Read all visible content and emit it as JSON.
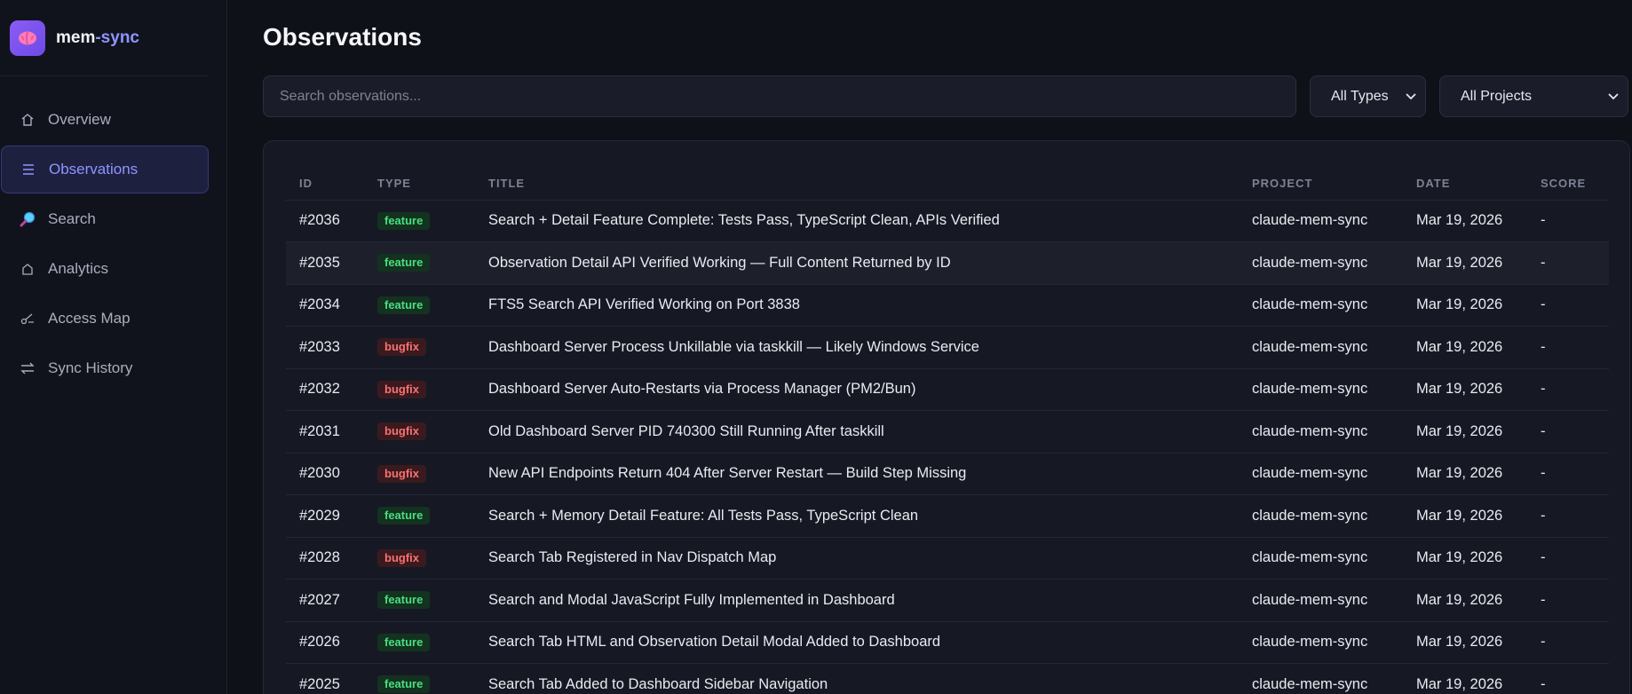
{
  "brand": {
    "name_main": "mem",
    "name_accent": "-sync"
  },
  "colors": {
    "accent": "#8f95ff",
    "feature": "#4ade80",
    "bugfix": "#f87171",
    "background": "#0f1118"
  },
  "sidebar": {
    "items": [
      {
        "label": "Overview",
        "icon": "home-icon",
        "active": false
      },
      {
        "label": "Observations",
        "icon": "list-icon",
        "active": true
      },
      {
        "label": "Search",
        "icon": "search-icon",
        "active": false
      },
      {
        "label": "Analytics",
        "icon": "analytics-icon",
        "active": false
      },
      {
        "label": "Access Map",
        "icon": "access-map-icon",
        "active": false
      },
      {
        "label": "Sync History",
        "icon": "sync-icon",
        "active": false
      }
    ]
  },
  "page": {
    "title": "Observations"
  },
  "filters": {
    "search_placeholder": "Search observations...",
    "type_selected": "All Types",
    "project_selected": "All Projects"
  },
  "table": {
    "headers": {
      "id": "ID",
      "type": "TYPE",
      "title": "TITLE",
      "project": "PROJECT",
      "date": "DATE",
      "score": "SCORE"
    },
    "rows": [
      {
        "id": "#2036",
        "type": "feature",
        "title": "Search + Detail Feature Complete: Tests Pass, TypeScript Clean, APIs Verified",
        "project": "claude-mem-sync",
        "date": "Mar 19, 2026",
        "score": "-"
      },
      {
        "id": "#2035",
        "type": "feature",
        "title": "Observation Detail API Verified Working — Full Content Returned by ID",
        "project": "claude-mem-sync",
        "date": "Mar 19, 2026",
        "score": "-"
      },
      {
        "id": "#2034",
        "type": "feature",
        "title": "FTS5 Search API Verified Working on Port 3838",
        "project": "claude-mem-sync",
        "date": "Mar 19, 2026",
        "score": "-"
      },
      {
        "id": "#2033",
        "type": "bugfix",
        "title": "Dashboard Server Process Unkillable via taskkill — Likely Windows Service",
        "project": "claude-mem-sync",
        "date": "Mar 19, 2026",
        "score": "-"
      },
      {
        "id": "#2032",
        "type": "bugfix",
        "title": "Dashboard Server Auto-Restarts via Process Manager (PM2/Bun)",
        "project": "claude-mem-sync",
        "date": "Mar 19, 2026",
        "score": "-"
      },
      {
        "id": "#2031",
        "type": "bugfix",
        "title": "Old Dashboard Server PID 740300 Still Running After taskkill",
        "project": "claude-mem-sync",
        "date": "Mar 19, 2026",
        "score": "-"
      },
      {
        "id": "#2030",
        "type": "bugfix",
        "title": "New API Endpoints Return 404 After Server Restart — Build Step Missing",
        "project": "claude-mem-sync",
        "date": "Mar 19, 2026",
        "score": "-"
      },
      {
        "id": "#2029",
        "type": "feature",
        "title": "Search + Memory Detail Feature: All Tests Pass, TypeScript Clean",
        "project": "claude-mem-sync",
        "date": "Mar 19, 2026",
        "score": "-"
      },
      {
        "id": "#2028",
        "type": "bugfix",
        "title": "Search Tab Registered in Nav Dispatch Map",
        "project": "claude-mem-sync",
        "date": "Mar 19, 2026",
        "score": "-"
      },
      {
        "id": "#2027",
        "type": "feature",
        "title": "Search and Modal JavaScript Fully Implemented in Dashboard",
        "project": "claude-mem-sync",
        "date": "Mar 19, 2026",
        "score": "-"
      },
      {
        "id": "#2026",
        "type": "feature",
        "title": "Search Tab HTML and Observation Detail Modal Added to Dashboard",
        "project": "claude-mem-sync",
        "date": "Mar 19, 2026",
        "score": "-"
      },
      {
        "id": "#2025",
        "type": "feature",
        "title": "Search Tab Added to Dashboard Sidebar Navigation",
        "project": "claude-mem-sync",
        "date": "Mar 19, 2026",
        "score": "-"
      }
    ]
  }
}
